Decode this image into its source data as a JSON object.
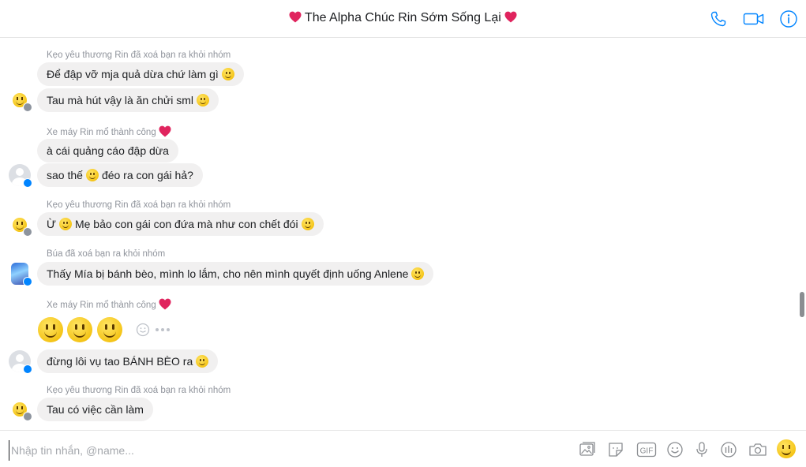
{
  "header": {
    "title": "The Alpha Chúc Rin Sớm Sống Lại",
    "icons": [
      "heart-icon",
      "phone-icon",
      "video-camera-icon",
      "info-icon"
    ],
    "accent_color": "#0084ff",
    "heart_color": "#e0245e"
  },
  "messages": {
    "groups": [
      {
        "sender": "Kẹo yêu thương Rin đã xoá bạn ra khỏi nhóm",
        "avatar": "smiley-avatar",
        "bubbles": [
          {
            "text": "Để đập vỡ mja quả dừa chứ làm gì",
            "emoji_after": true
          },
          {
            "text": "Tau mà hút vậy là ăn chửi sml",
            "emoji_after": true
          }
        ]
      },
      {
        "sender": "Xe máy Rin mổ thành công",
        "avatar": "default-avatar",
        "bubbles": [
          {
            "text": "à cái quảng cáo đập dừa"
          },
          {
            "text_before": "sao thế",
            "text_after": "đéo ra con gái hả?"
          }
        ]
      },
      {
        "sender": "Kẹo yêu thương Rin đã xoá bạn ra khỏi nhóm",
        "avatar": "smiley-avatar",
        "bubbles": [
          {
            "text_before": "Ừ",
            "text_after": "Mẹ bảo con gái con đứa mà như con chết đói",
            "emoji_after": true
          }
        ]
      },
      {
        "sender": "Búa đã xoá bạn ra khỏi nhóm",
        "avatar": "photo-avatar",
        "bubbles": [
          {
            "text": "Thấy Mía bị bánh bèo, mình lo lắm, cho nên mình quyết định uống Anlene",
            "emoji_after": true
          }
        ]
      },
      {
        "sender": "Xe máy Rin mổ thành công",
        "avatar": "default-avatar",
        "bubbles": [
          {
            "emoji_only": 3
          },
          {
            "text": "đừng lôi vụ tao BÁNH BÈO ra",
            "emoji_after": true
          }
        ]
      },
      {
        "sender": "Kẹo yêu thương Rin đã xoá bạn ra khỏi nhóm",
        "avatar": "smiley-avatar",
        "bubbles": [
          {
            "text": "Tau có việc cần làm"
          }
        ]
      }
    ]
  },
  "composer": {
    "placeholder": "Nhập tin nhắn, @name...",
    "tools": [
      "image-icon",
      "sticker-icon",
      "gif-icon",
      "emoji-icon",
      "microphone-icon",
      "poll-icon",
      "camera-icon",
      "like-emoji-icon"
    ]
  }
}
